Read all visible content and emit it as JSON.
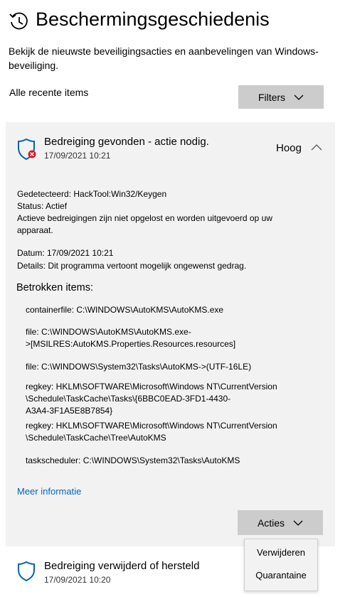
{
  "header": {
    "title": "Beschermingsgeschiedenis",
    "description": "Bekijk de nieuwste beveiligingsacties en aanbevelingen van Windows-beveiliging."
  },
  "toolbar": {
    "recent_label": "Alle recente items",
    "filters_label": "Filters"
  },
  "threat": {
    "title": "Bedreiging gevonden - actie nodig.",
    "date": "17/09/2021 10:21",
    "severity": "Hoog",
    "detected": "Gedetecteerd: HackTool:Win32/Keygen",
    "status": "Status: Actief",
    "status_desc": "Actieve bedreigingen zijn niet opgelost en worden uitgevoerd op uw apparaat.",
    "datum": "Datum: 17/09/2021 10:21",
    "details": "Details: Dit programma vertoont mogelijk ongewenst gedrag.",
    "affected_heading": "Betrokken items:",
    "items": [
      {
        "line1": "containerfile: C:\\WINDOWS\\AutoKMS\\AutoKMS.exe"
      },
      {
        "line1": "file: C:\\WINDOWS\\AutoKMS\\AutoKMS.exe-",
        "line2": ">[MSILRES:AutoKMS.Properties.Resources.resources]"
      },
      {
        "line1": "file: C:\\WINDOWS\\System32\\Tasks\\AutoKMS->(UTF-16LE)"
      },
      {
        "line1": "regkey: HKLM\\SOFTWARE\\Microsoft\\Windows NT\\CurrentVersion",
        "line2": "\\Schedule\\TaskCache\\Tasks\\{6BBC0EAD-3FD1-4430-",
        "line3": "A3A4-3F1A5E8B7854}"
      },
      {
        "line1": "regkey: HKLM\\SOFTWARE\\Microsoft\\Windows NT\\CurrentVersion",
        "line2": "\\Schedule\\TaskCache\\Tree\\AutoKMS"
      },
      {
        "line1": "taskscheduler: C:\\WINDOWS\\System32\\Tasks\\AutoKMS"
      }
    ],
    "more_info": "Meer informatie",
    "actions_label": "Acties"
  },
  "actions_menu": {
    "remove": "Verwijderen",
    "quarantine": "Quarantaine"
  },
  "threat2": {
    "title": "Bedreiging verwijderd of hersteld",
    "date": "17/09/2021 10:20"
  },
  "colors": {
    "link": "#0067c0",
    "shield": "#0063b1",
    "alert": "#e81123",
    "button": "#cccccc",
    "card": "#f2f2f2"
  },
  "icons": [
    "history-icon",
    "shield-alert-icon",
    "chevron-up-icon",
    "chevron-down-icon",
    "shield-icon"
  ]
}
